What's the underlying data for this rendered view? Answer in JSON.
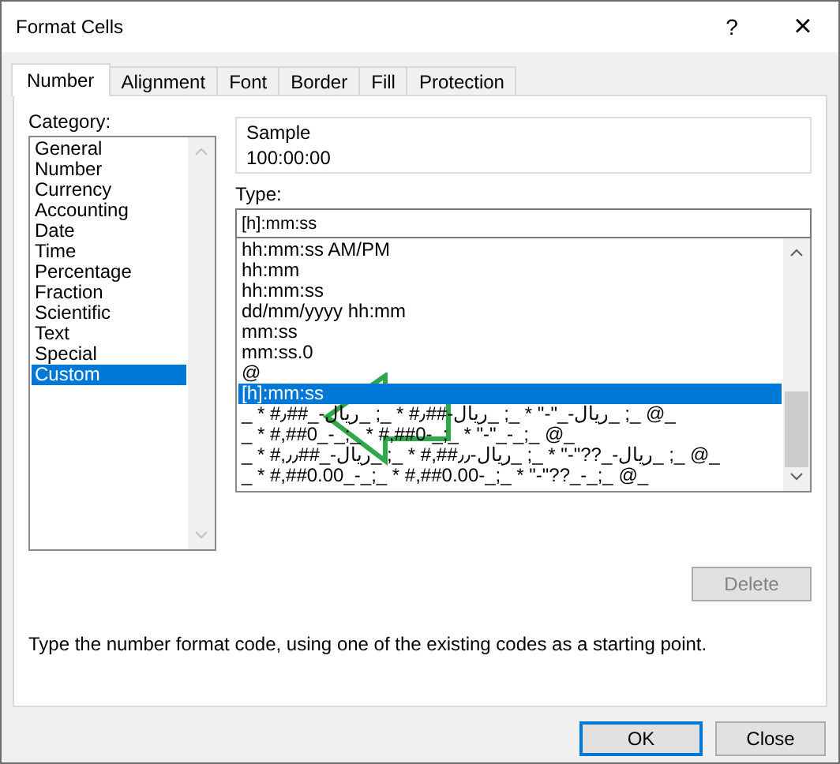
{
  "window": {
    "title": "Format Cells",
    "help": "?",
    "close": "×"
  },
  "tabs": [
    {
      "label": "Number",
      "selected": true
    },
    {
      "label": "Alignment",
      "selected": false
    },
    {
      "label": "Font",
      "selected": false
    },
    {
      "label": "Border",
      "selected": false
    },
    {
      "label": "Fill",
      "selected": false
    },
    {
      "label": "Protection",
      "selected": false
    }
  ],
  "category": {
    "label": "Category:",
    "items": [
      {
        "label": "General",
        "selected": false
      },
      {
        "label": "Number",
        "selected": false
      },
      {
        "label": "Currency",
        "selected": false
      },
      {
        "label": "Accounting",
        "selected": false
      },
      {
        "label": "Date",
        "selected": false
      },
      {
        "label": "Time",
        "selected": false
      },
      {
        "label": "Percentage",
        "selected": false
      },
      {
        "label": "Fraction",
        "selected": false
      },
      {
        "label": "Scientific",
        "selected": false
      },
      {
        "label": "Text",
        "selected": false
      },
      {
        "label": "Special",
        "selected": false
      },
      {
        "label": "Custom",
        "selected": true
      }
    ]
  },
  "sample": {
    "label": "Sample",
    "value": "100:00:00"
  },
  "type": {
    "label": "Type:",
    "value": "[h]:mm:ss"
  },
  "formats": [
    {
      "label": "hh:mm:ss AM/PM",
      "selected": false
    },
    {
      "label": "hh:mm",
      "selected": false
    },
    {
      "label": "hh:mm:ss",
      "selected": false
    },
    {
      "label": "dd/mm/yyyy hh:mm",
      "selected": false
    },
    {
      "label": "mm:ss",
      "selected": false
    },
    {
      "label": "mm:ss.0",
      "selected": false
    },
    {
      "label": "@",
      "selected": false
    },
    {
      "label": "[h]:mm:ss",
      "selected": true
    },
    {
      "label": "_@ _; _ریال-_\"-\" * _; _ریال-##٫# * _; _ریال-_##٫# * _",
      "selected": false
    },
    {
      "label": "_ * #,##0_-_;_ * #,##0-_;_ * \"-\"_-_;_ @_",
      "selected": false
    },
    {
      "label": "_@ _; _ریال-_??\"-\" * _; _ریال-٫٫##,# * _; _ریال-_##٫٫,# * _",
      "selected": false
    },
    {
      "label": "_ * #,##0.00_-_;_ * #,##0.00-_;_ * \"-\"??_-_;_ @_",
      "selected": false
    }
  ],
  "delete_button": {
    "label": "Delete",
    "disabled": true
  },
  "description": "Type the number format code, using one of the existing codes as a starting point.",
  "buttons": [
    {
      "label": "OK",
      "kind": "default"
    },
    {
      "label": "Close",
      "kind": "normal"
    }
  ]
}
